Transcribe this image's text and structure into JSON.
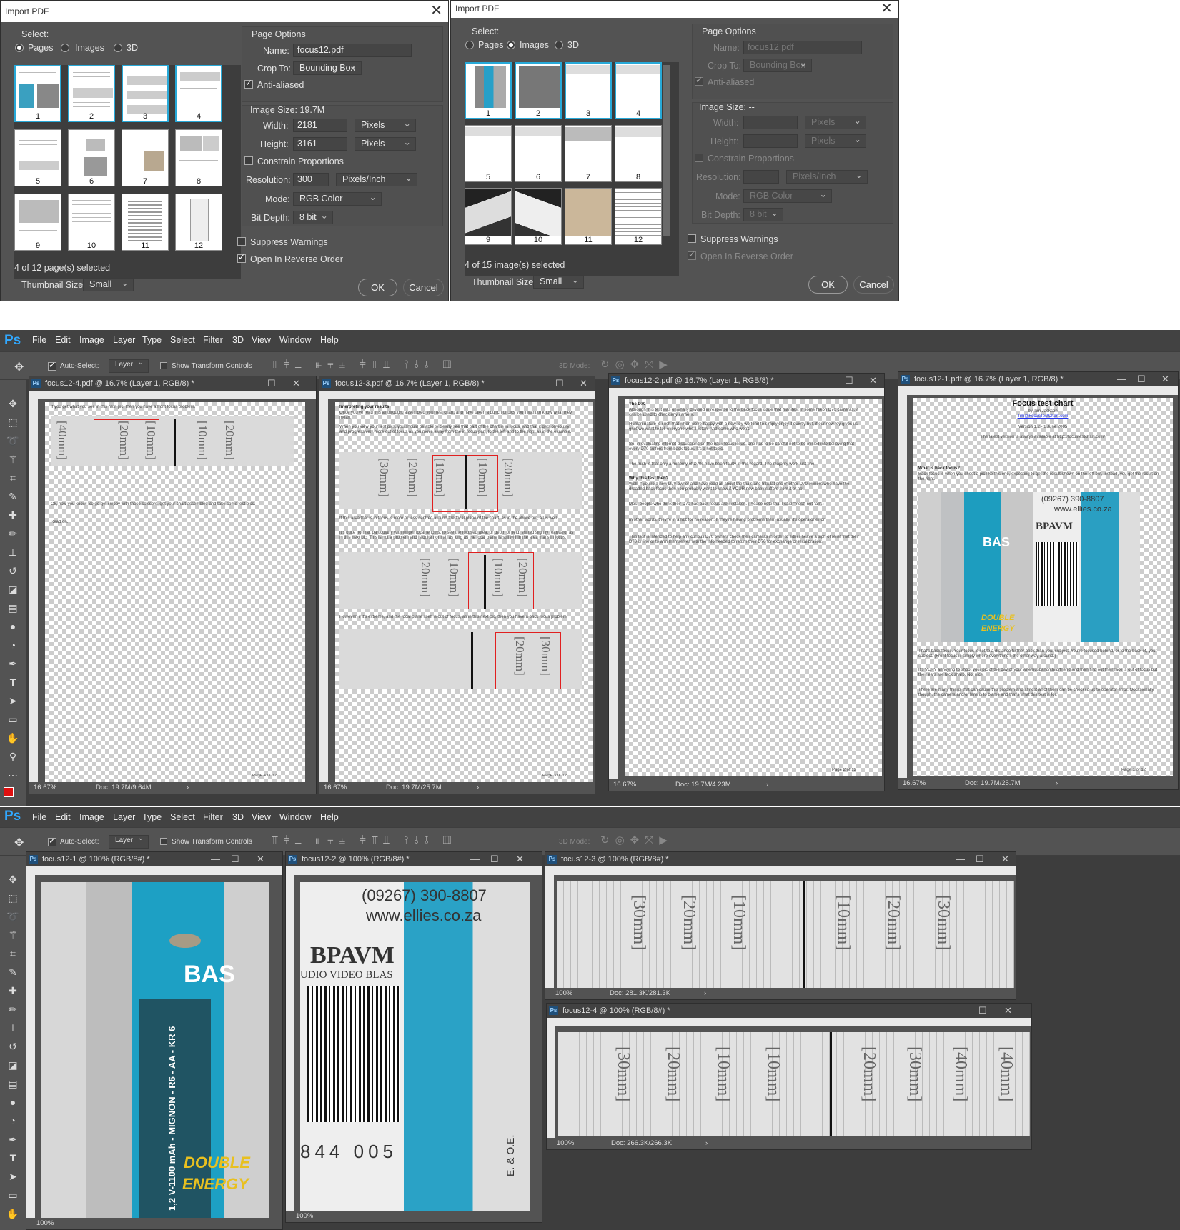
{
  "dialog1": {
    "title": "Import PDF",
    "select_label": "Select:",
    "modes": [
      "Pages",
      "Images",
      "3D"
    ],
    "thumbs": [
      "1",
      "2",
      "3",
      "4",
      "5",
      "6",
      "7",
      "8",
      "9",
      "10",
      "11",
      "12"
    ],
    "selected_info": "4 of 12 page(s) selected",
    "thumb_size_label": "Thumbnail Size:",
    "thumb_size": "Small",
    "page_options": "Page Options",
    "name_label": "Name:",
    "name": "focus12.pdf",
    "crop_label": "Crop To:",
    "crop": "Bounding Box",
    "anti_aliased": "Anti-aliased",
    "image_size": "Image Size: 19.7M",
    "width_label": "Width:",
    "width": "2181",
    "height_label": "Height:",
    "height": "3161",
    "unit": "Pixels",
    "constrain": "Constrain Proportions",
    "resolution_label": "Resolution:",
    "resolution": "300",
    "res_unit": "Pixels/Inch",
    "mode_label": "Mode:",
    "mode": "RGB Color",
    "depth_label": "Bit Depth:",
    "depth": "8 bit",
    "suppress": "Suppress Warnings",
    "reverse": "Open In Reverse Order",
    "ok": "OK",
    "cancel": "Cancel"
  },
  "dialog2": {
    "title": "Import PDF",
    "select_label": "Select:",
    "modes": [
      "Pages",
      "Images",
      "3D"
    ],
    "thumbs": [
      "1",
      "2",
      "3",
      "4",
      "5",
      "6",
      "7",
      "8",
      "9",
      "10",
      "11",
      "12"
    ],
    "selected_info": "4 of 15 image(s) selected",
    "thumb_size_label": "Thumbnail Size:",
    "thumb_size": "Small",
    "page_options": "Page Options",
    "name_label": "Name:",
    "name": "focus12.pdf",
    "crop_label": "Crop To:",
    "crop": "Bounding Box",
    "anti_aliased": "Anti-aliased",
    "image_size": "Image Size: --",
    "width_label": "Width:",
    "height_label": "Height:",
    "unit": "Pixels",
    "constrain": "Constrain Proportions",
    "resolution_label": "Resolution:",
    "res_unit": "Pixels/Inch",
    "mode_label": "Mode:",
    "mode": "RGB Color",
    "depth_label": "Bit Depth:",
    "depth": "8 bit",
    "suppress": "Suppress Warnings",
    "reverse": "Open In Reverse Order",
    "ok": "OK",
    "cancel": "Cancel"
  },
  "app": {
    "logo": "Ps",
    "menu": [
      "File",
      "Edit",
      "Image",
      "Layer",
      "Type",
      "Select",
      "Filter",
      "3D",
      "View",
      "Window",
      "Help"
    ],
    "auto_select": "Auto-Select:",
    "layer": "Layer",
    "transform": "Show Transform Controls",
    "mode3d": "3D Mode:"
  },
  "docs_top": [
    {
      "title": "focus12-4.pdf @ 16.7% (Layer 1, RGB/8) *",
      "zoom": "16.67%",
      "doc": "Doc: 19.7M/9.64M",
      "page": "Page 4 of 12"
    },
    {
      "title": "focus12-3.pdf @ 16.7% (Layer 1, RGB/8) *",
      "zoom": "16.67%",
      "doc": "Doc: 19.7M/25.7M",
      "page": "Page 3 of 12"
    },
    {
      "title": "focus12-2.pdf @ 16.7% (Layer 1, RGB/8) *",
      "zoom": "16.67%",
      "doc": "Doc: 19.7M/4.23M",
      "page": "Page 2 of 12"
    },
    {
      "title": "focus12-1.pdf @ 16.7% (Layer 1, RGB/8) *",
      "zoom": "16.67%",
      "doc": "Doc: 19.7M/25.7M",
      "page": "Page 1 of 12"
    }
  ],
  "doc_text": {
    "d4_line1": "If you get what you see in this next pic, then you have a front focus problem.",
    "d4_line2": "Ok, now you know! So go get snippy with those scissors, get your chart assembled and take some test pics.",
    "d4_line3": "Read on.",
    "d3_heading": "Interpreting your results",
    "d3_p1": "Once you've read this all through, assembled your test chart, and have taken a bunch of pics you'll want to know what they mean.",
    "d3_p2": "When you view your test pics, you should be able to clearly see that part of the chart is in focus, and that it gets obviously and progressively more out of focus as you move away from the in focus part, to the left and to the right as in the example.",
    "d3_p3": "If this area that is in focus is more or less centred around the focal plane of the chart, as in the above pic, all is well.",
    "d3_p4": "It's quite normal, particularly with longer focal lengths, to see the focused area, or depth of field, shifted slightly rearward, as in this next pic. This is not a problem and is quite normal, as long as the focal plane is still within the area that's in focus.",
    "d3_p5": "However, if it's extreme, and the focal plane itself is out of focus, as in this next pic, then you have a back focus problem.",
    "d2_heading": "The D70",
    "d2_p1": "Although this test was originally devised in response to the back focus issue that manifest in some Nikon D70 cameras, it can be used to check any camera.",
    "d2_p2": "Human nature is such that when we're happy with a new toy we tend to simply enjoy it quietly but, if our new toy gives us grief we want to tell everyone who'll listen. And some who won't.",
    "d2_p3": "So, in evaluating internet discussions on the back focus issue, one has to be careful not to be misled into believing that every D70 suffers from back focus. It's a hot topic.",
    "d2_p4": "The truth is that only a minority of D70s have been faulty in this regard. The majority work just fine.",
    "d2_h2": "Why this test then?",
    "d2_p5": "Well, if you're a new D70 owner and have read all about the trials and tribulations of other D70 owners who have the dreaded back focus then you probably want to know if YOUR new baby suffers from it or not.",
    "d2_p6": "Most people who think their D70 has back focus are mistaken. (Please note that I said \"most\" not \"all\".)",
    "d2_p7": "In other words, they're in a fizz for no reason. If they're having problems then, usually, it's operator error.",
    "d2_p8": "This test is intended to help any curious D70 owners check their cameras in order to either heave a sigh of relief that their D70 is fine or to arm themselves with the info needed to return their D70 for exchange or recalibration.",
    "d1_title": "Focus test chart",
    "d1_by": "by Tim Jackson",
    "d1_link": "Tim@FocusTestChart.com",
    "d1_ver": "Version 1.2 - 1 June 2005",
    "d1_latest": "The latest version is always available at http://focustestchart.com/",
    "d1_h": "What is back focus?",
    "d1_p1": "Back focus is when you shoot a pic like this one, expecting to get the result shown on the left but, instead, you get the result on the right.",
    "d1_p2": "That's back focus. Your focus is set to a distance further back than your subject. You're focused behind, or to the back of, your subject. (Front focus is simply where everything's the other way around.)",
    "d1_p3": "It's VERY annoying to shoot your pic of the day of your wife/husband/child/friend and then find out their face is out of focus but their ears are tack sharp. Not nice.",
    "d1_p4": "There are many things that can cause this problem and almost all of them can be checked up to operator error. Occasionally though, the camera and/or lens is to blame and that's what this test is for."
  },
  "docs_bottom": [
    {
      "title": "focus12-1 @ 100% (RGB/8#) *",
      "zoom": "100%"
    },
    {
      "title": "focus12-2 @ 100% (RGB/8#) *",
      "zoom": "100%"
    },
    {
      "title": "focus12-3 @ 100% (RGB/8#) *",
      "zoom": "100%",
      "doc": "Doc: 281.3K/281.3K"
    },
    {
      "title": "focus12-4 @ 100% (RGB/8#) *",
      "zoom": "100%",
      "doc": "Doc: 266.3K/266.3K"
    }
  ],
  "photo_text": {
    "phone": "(09267) 390-8807",
    "web": "www.ellies.co.za",
    "brand": "BPAVM",
    "sub": "UDIO VIDEO BLAS",
    "bas": "BAS",
    "double": "DOUBLE",
    "energy": "ENERGY",
    "battery": "1,2 V-1100 mAh - MIGNON - R6 - AA - KR 6",
    "barcode": "844 005",
    "eoe": "E. & O.E."
  },
  "chart_marks": [
    "[40mm]",
    "[30mm]",
    "[20mm]",
    "[10mm]",
    "[10mm]",
    "[20mm]",
    "[30mm]",
    "[40mm]"
  ],
  "colors": {
    "ps_blue": "#31a8ff",
    "selection": "#27a9d8",
    "red": "#e02020"
  }
}
